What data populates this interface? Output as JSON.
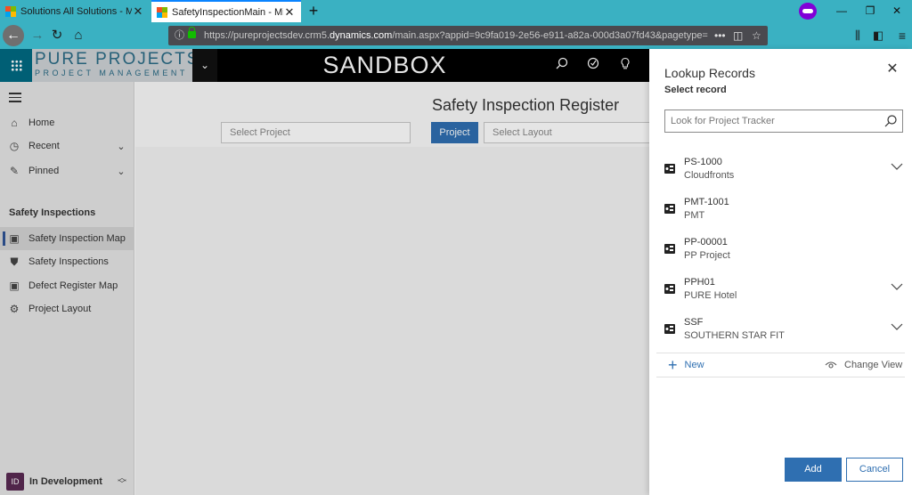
{
  "browser": {
    "tabs": [
      {
        "title": "Solutions All Solutions - Microsof",
        "active": false
      },
      {
        "title": "SafetyInspectionMain - Microsoft",
        "active": true
      }
    ],
    "url_prefix": "https://pureprojectsdev.crm5.",
    "url_domain": "dynamics.com",
    "url_suffix": "/main.aspx?appid=9c9fa019-2e56-e911-a82a-000d3a07fd43&pagetype=",
    "icons": [
      "back-icon",
      "forward-icon",
      "reload-icon",
      "home-icon",
      "info-icon",
      "lock-icon",
      "more-icon",
      "pocket-icon",
      "bookmark-star-icon",
      "library-icon",
      "sidebar-icon",
      "menu-icon",
      "private-browsing-icon"
    ]
  },
  "app": {
    "brand_line1": "PURE PROJECTS",
    "brand_line2": "PROJECT MANAGEMENT",
    "environment": "SANDBOX",
    "header_icons": [
      "search-icon",
      "tasks-icon",
      "lightbulb-icon"
    ]
  },
  "sidebar": {
    "items": [
      {
        "label": "Home",
        "icon": "home-icon"
      },
      {
        "label": "Recent",
        "icon": "clock-icon"
      },
      {
        "label": "Pinned",
        "icon": "pin-icon"
      }
    ],
    "section_title": "Safety Inspections",
    "section_items": [
      {
        "label": "Safety Inspection Map",
        "selected": true
      },
      {
        "label": "Safety Inspections",
        "selected": false
      },
      {
        "label": "Defect Register Map",
        "selected": false
      },
      {
        "label": "Project Layout",
        "selected": false
      }
    ],
    "footer_badge": "ID",
    "footer_label": "In Development"
  },
  "main": {
    "title": "Safety Inspection Register",
    "select_project_placeholder": "Select Project",
    "project_button": "Project",
    "select_layout_placeholder": "Select Layout"
  },
  "lookup": {
    "title": "Lookup Records",
    "subtitle": "Select record",
    "search_placeholder": "Look for Project Tracker",
    "records": [
      {
        "code": "PS-1000",
        "name": "Cloudfronts",
        "expandable": true
      },
      {
        "code": "PMT-1001",
        "name": "PMT",
        "expandable": false
      },
      {
        "code": "PP-00001",
        "name": "PP Project",
        "expandable": false
      },
      {
        "code": "PPH01",
        "name": "PURE Hotel",
        "expandable": true
      },
      {
        "code": "SSF",
        "name": "SOUTHERN STAR FIT",
        "expandable": true
      }
    ],
    "new_label": "New",
    "change_view_label": "Change View",
    "add_label": "Add",
    "cancel_label": "Cancel"
  },
  "colors": {
    "browser_chrome": "#3ab1c2",
    "accent_blue": "#2f6fb1",
    "brand_teal": "#2a6b86",
    "env_badge": "#5a2a53"
  }
}
